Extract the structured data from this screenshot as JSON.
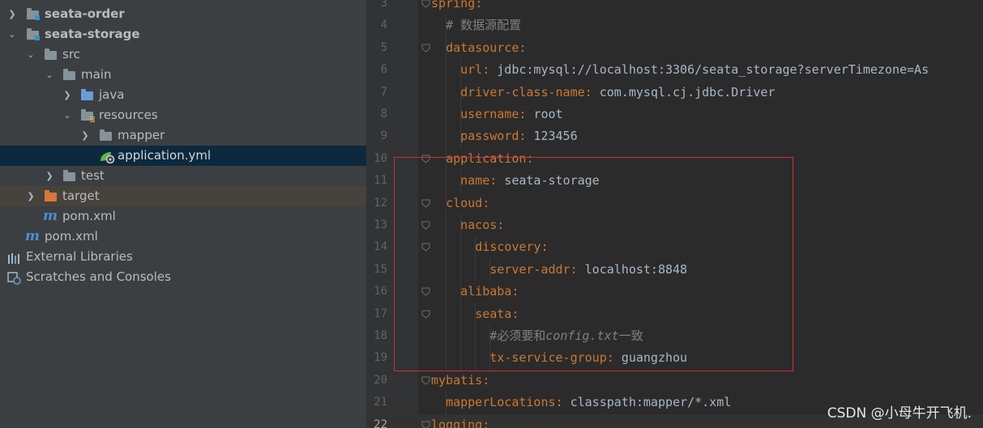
{
  "project_tree": {
    "items": [
      {
        "label": "seata-order",
        "icon": "module-folder-icon",
        "arrow": "collapsed",
        "bold": true
      },
      {
        "label": "seata-storage",
        "icon": "module-folder-icon",
        "arrow": "expanded",
        "bold": true
      },
      {
        "label": "src",
        "icon": "folder-icon",
        "arrow": "expanded"
      },
      {
        "label": "main",
        "icon": "folder-icon",
        "arrow": "expanded"
      },
      {
        "label": "java",
        "icon": "source-folder-icon",
        "arrow": "collapsed"
      },
      {
        "label": "resources",
        "icon": "resources-folder-icon",
        "arrow": "expanded"
      },
      {
        "label": "mapper",
        "icon": "folder-icon",
        "arrow": "collapsed"
      },
      {
        "label": "application.yml",
        "icon": "spring-yml-icon",
        "arrow": "none",
        "selected": true
      },
      {
        "label": "test",
        "icon": "folder-icon",
        "arrow": "collapsed"
      },
      {
        "label": "target",
        "icon": "excluded-folder-icon",
        "arrow": "collapsed",
        "excluded": true
      },
      {
        "label": "pom.xml",
        "icon": "maven-icon",
        "arrow": "none"
      },
      {
        "label": "pom.xml",
        "icon": "maven-icon",
        "arrow": "none"
      },
      {
        "label": "External Libraries",
        "icon": "libraries-icon",
        "arrow": "collapsed"
      },
      {
        "label": "Scratches and Consoles",
        "icon": "scratches-icon",
        "arrow": "collapsed"
      }
    ]
  },
  "editor": {
    "lines": [
      {
        "no": "3",
        "text": "spring:"
      },
      {
        "no": "4",
        "text": "  # 数据源配置"
      },
      {
        "no": "5",
        "text": "  datasource:"
      },
      {
        "no": "6",
        "text": "    url: jdbc:mysql://localhost:3306/seata_storage?serverTimezone=As"
      },
      {
        "no": "7",
        "text": "    driver-class-name: com.mysql.cj.jdbc.Driver"
      },
      {
        "no": "8",
        "text": "    username: root"
      },
      {
        "no": "9",
        "text": "    password: 123456"
      },
      {
        "no": "10",
        "text": "  application:"
      },
      {
        "no": "11",
        "text": "    name: seata-storage"
      },
      {
        "no": "12",
        "text": "  cloud:"
      },
      {
        "no": "13",
        "text": "    nacos:"
      },
      {
        "no": "14",
        "text": "      discovery:"
      },
      {
        "no": "15",
        "text": "        server-addr: localhost:8848"
      },
      {
        "no": "16",
        "text": "    alibaba:"
      },
      {
        "no": "17",
        "text": "      seata:"
      },
      {
        "no": "18",
        "text": "        #必须要和config.txt一致"
      },
      {
        "no": "19",
        "text": "        tx-service-group: guangzhou"
      },
      {
        "no": "20",
        "text": "mybatis:"
      },
      {
        "no": "21",
        "text": "  mapperLocations: classpath:mapper/*.xml"
      },
      {
        "no": "22",
        "text": "logging:"
      }
    ],
    "current_line": "22"
  },
  "watermark": "CSDN @小母牛开飞机.",
  "colors": {
    "key": "#cc7832",
    "value": "#a9b7c6",
    "comment": "#808080",
    "highlight_border": "#c8313a",
    "selected_row": "#0d293e"
  }
}
